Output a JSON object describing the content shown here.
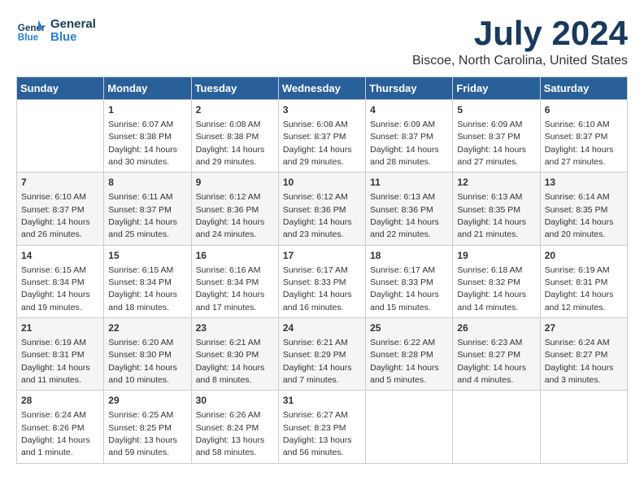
{
  "logo": {
    "line1": "General",
    "line2": "Blue"
  },
  "title": "July 2024",
  "subtitle": "Biscoe, North Carolina, United States",
  "days_of_week": [
    "Sunday",
    "Monday",
    "Tuesday",
    "Wednesday",
    "Thursday",
    "Friday",
    "Saturday"
  ],
  "weeks": [
    [
      {
        "day": "",
        "content": ""
      },
      {
        "day": "1",
        "content": "Sunrise: 6:07 AM\nSunset: 8:38 PM\nDaylight: 14 hours\nand 30 minutes."
      },
      {
        "day": "2",
        "content": "Sunrise: 6:08 AM\nSunset: 8:38 PM\nDaylight: 14 hours\nand 29 minutes."
      },
      {
        "day": "3",
        "content": "Sunrise: 6:08 AM\nSunset: 8:37 PM\nDaylight: 14 hours\nand 29 minutes."
      },
      {
        "day": "4",
        "content": "Sunrise: 6:09 AM\nSunset: 8:37 PM\nDaylight: 14 hours\nand 28 minutes."
      },
      {
        "day": "5",
        "content": "Sunrise: 6:09 AM\nSunset: 8:37 PM\nDaylight: 14 hours\nand 27 minutes."
      },
      {
        "day": "6",
        "content": "Sunrise: 6:10 AM\nSunset: 8:37 PM\nDaylight: 14 hours\nand 27 minutes."
      }
    ],
    [
      {
        "day": "7",
        "content": "Sunrise: 6:10 AM\nSunset: 8:37 PM\nDaylight: 14 hours\nand 26 minutes."
      },
      {
        "day": "8",
        "content": "Sunrise: 6:11 AM\nSunset: 8:37 PM\nDaylight: 14 hours\nand 25 minutes."
      },
      {
        "day": "9",
        "content": "Sunrise: 6:12 AM\nSunset: 8:36 PM\nDaylight: 14 hours\nand 24 minutes."
      },
      {
        "day": "10",
        "content": "Sunrise: 6:12 AM\nSunset: 8:36 PM\nDaylight: 14 hours\nand 23 minutes."
      },
      {
        "day": "11",
        "content": "Sunrise: 6:13 AM\nSunset: 8:36 PM\nDaylight: 14 hours\nand 22 minutes."
      },
      {
        "day": "12",
        "content": "Sunrise: 6:13 AM\nSunset: 8:35 PM\nDaylight: 14 hours\nand 21 minutes."
      },
      {
        "day": "13",
        "content": "Sunrise: 6:14 AM\nSunset: 8:35 PM\nDaylight: 14 hours\nand 20 minutes."
      }
    ],
    [
      {
        "day": "14",
        "content": "Sunrise: 6:15 AM\nSunset: 8:34 PM\nDaylight: 14 hours\nand 19 minutes."
      },
      {
        "day": "15",
        "content": "Sunrise: 6:15 AM\nSunset: 8:34 PM\nDaylight: 14 hours\nand 18 minutes."
      },
      {
        "day": "16",
        "content": "Sunrise: 6:16 AM\nSunset: 8:34 PM\nDaylight: 14 hours\nand 17 minutes."
      },
      {
        "day": "17",
        "content": "Sunrise: 6:17 AM\nSunset: 8:33 PM\nDaylight: 14 hours\nand 16 minutes."
      },
      {
        "day": "18",
        "content": "Sunrise: 6:17 AM\nSunset: 8:33 PM\nDaylight: 14 hours\nand 15 minutes."
      },
      {
        "day": "19",
        "content": "Sunrise: 6:18 AM\nSunset: 8:32 PM\nDaylight: 14 hours\nand 14 minutes."
      },
      {
        "day": "20",
        "content": "Sunrise: 6:19 AM\nSunset: 8:31 PM\nDaylight: 14 hours\nand 12 minutes."
      }
    ],
    [
      {
        "day": "21",
        "content": "Sunrise: 6:19 AM\nSunset: 8:31 PM\nDaylight: 14 hours\nand 11 minutes."
      },
      {
        "day": "22",
        "content": "Sunrise: 6:20 AM\nSunset: 8:30 PM\nDaylight: 14 hours\nand 10 minutes."
      },
      {
        "day": "23",
        "content": "Sunrise: 6:21 AM\nSunset: 8:30 PM\nDaylight: 14 hours\nand 8 minutes."
      },
      {
        "day": "24",
        "content": "Sunrise: 6:21 AM\nSunset: 8:29 PM\nDaylight: 14 hours\nand 7 minutes."
      },
      {
        "day": "25",
        "content": "Sunrise: 6:22 AM\nSunset: 8:28 PM\nDaylight: 14 hours\nand 5 minutes."
      },
      {
        "day": "26",
        "content": "Sunrise: 6:23 AM\nSunset: 8:27 PM\nDaylight: 14 hours\nand 4 minutes."
      },
      {
        "day": "27",
        "content": "Sunrise: 6:24 AM\nSunset: 8:27 PM\nDaylight: 14 hours\nand 3 minutes."
      }
    ],
    [
      {
        "day": "28",
        "content": "Sunrise: 6:24 AM\nSunset: 8:26 PM\nDaylight: 14 hours\nand 1 minute."
      },
      {
        "day": "29",
        "content": "Sunrise: 6:25 AM\nSunset: 8:25 PM\nDaylight: 13 hours\nand 59 minutes."
      },
      {
        "day": "30",
        "content": "Sunrise: 6:26 AM\nSunset: 8:24 PM\nDaylight: 13 hours\nand 58 minutes."
      },
      {
        "day": "31",
        "content": "Sunrise: 6:27 AM\nSunset: 8:23 PM\nDaylight: 13 hours\nand 56 minutes."
      },
      {
        "day": "",
        "content": ""
      },
      {
        "day": "",
        "content": ""
      },
      {
        "day": "",
        "content": ""
      }
    ]
  ]
}
